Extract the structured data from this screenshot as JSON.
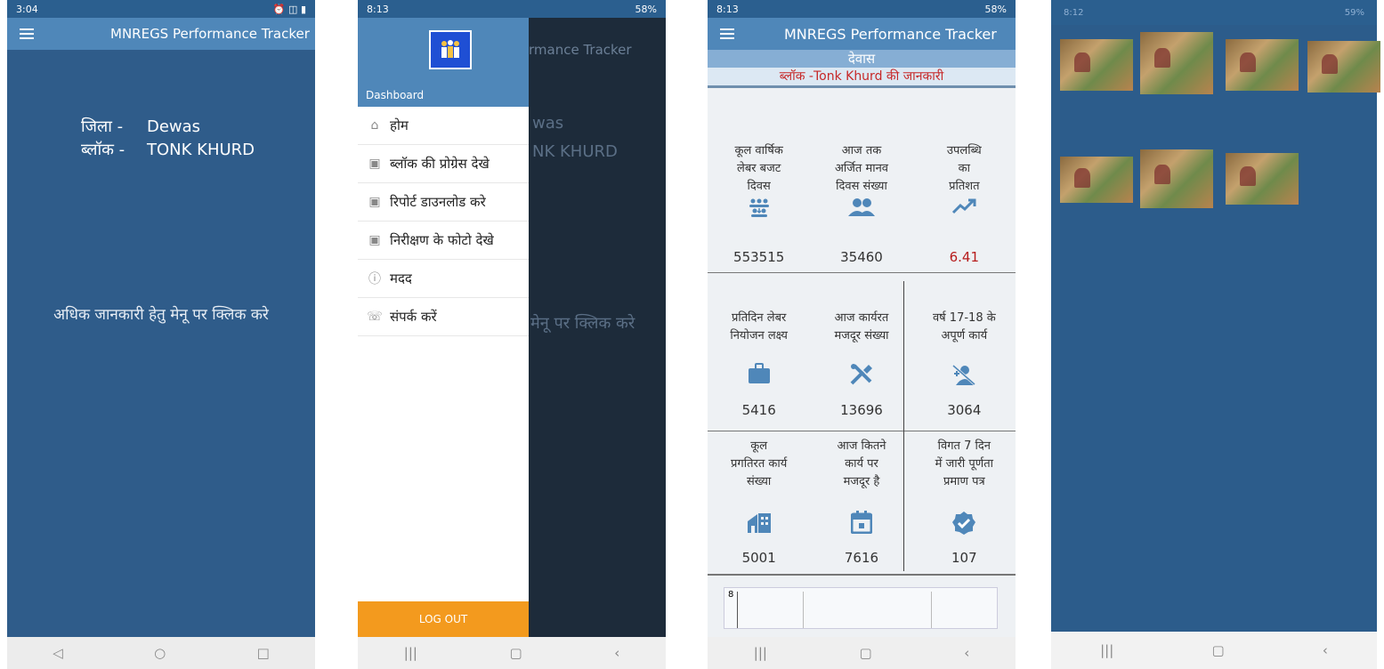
{
  "phone1": {
    "status_time": "3:04",
    "app_title": "MNREGS Performance Tracker",
    "district_label": "जिला -",
    "district_value": "Dewas",
    "block_label": "ब्लॉक -",
    "block_value": "TONK KHURD",
    "more_info": "अधिक जानकारी हेतु मेनू पर क्लिक करे"
  },
  "phone2": {
    "status_time": "8:13",
    "battery": "58%",
    "behind_title": "rmance Tracker",
    "behind_line1": "was",
    "behind_line2": "NK KHURD",
    "behind_line3": "मेनू पर क्लिक करे",
    "drawer_header": "Dashboard",
    "menu": [
      {
        "icon": "home-icon",
        "label": "होम"
      },
      {
        "icon": "play-square-icon",
        "label": "ब्लॉक की प्रोग्रेस देखे"
      },
      {
        "icon": "play-square-icon",
        "label": "रिपोर्ट डाउनलोड करे"
      },
      {
        "icon": "play-square-icon",
        "label": "निरीक्षण के फोटो देखे"
      },
      {
        "icon": "info-icon",
        "label": "मदद"
      },
      {
        "icon": "phone-icon",
        "label": "संपर्क करें"
      }
    ],
    "logout": "LOG OUT"
  },
  "phone3": {
    "status_time": "8:13",
    "battery": "58%",
    "app_title": "MNREGS Performance Tracker",
    "district": "देवास",
    "block_info": "ब्लॉक -Tonk Khurd की जानकारी",
    "stats": [
      {
        "label1": "कूल वार्षिक",
        "label2": "लेबर बजट",
        "label3": "दिवस",
        "icon": "group-icon",
        "value": "553515"
      },
      {
        "label1": "आज तक",
        "label2": "अर्जित मानव",
        "label3": "दिवस संख्या",
        "icon": "people-icon",
        "value": "35460"
      },
      {
        "label1": "उपलब्धि",
        "label2": "का",
        "label3": "प्रतिशत",
        "icon": "trending-up-icon",
        "value": "6.41"
      },
      {
        "label1": "प्रतिदिन लेबर",
        "label2": "नियोजन लक्ष्य",
        "label3": "",
        "icon": "briefcase-icon",
        "value": "5416"
      },
      {
        "label1": "आज कार्यरत",
        "label2": "मजदूर संख्या",
        "label3": "",
        "icon": "tools-icon",
        "value": "13696"
      },
      {
        "label1": "वर्ष 17-18 के",
        "label2": "अपूर्ण कार्य",
        "label3": "",
        "icon": "person-off-icon",
        "value": "3064"
      },
      {
        "label1": "कूल",
        "label2": "प्रगतिरत कार्य",
        "label3": "संख्या",
        "icon": "building-icon",
        "value": "5001"
      },
      {
        "label1": "आज कितने",
        "label2": "कार्य पर",
        "label3": "मजदूर है",
        "icon": "calendar-icon",
        "value": "7616"
      },
      {
        "label1": "विगत 7 दिन",
        "label2": "में जारी पूर्णता",
        "label3": "प्रमाण पत्र",
        "icon": "verified-icon",
        "value": "107"
      }
    ],
    "chart_tick": "8"
  },
  "phone4": {
    "status_time": "8:12",
    "battery": "59%"
  },
  "colors": {
    "primary": "#4f87b9",
    "dark_blue": "#2f5c8a",
    "accent_orange": "#f39a1e",
    "value_red": "#b71c1c"
  }
}
